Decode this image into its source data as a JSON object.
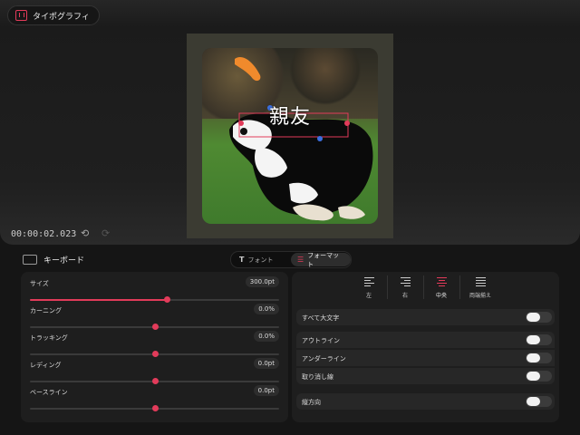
{
  "app": {
    "title": "タイポグラフィ"
  },
  "canvas": {
    "overlay_text": "親友"
  },
  "playback": {
    "timecode": "00:00:02.023",
    "undo_symbol": "⟲",
    "redo_symbol": "⟳"
  },
  "keyboard": {
    "label": "キーボード"
  },
  "tabs": {
    "font": "フォント",
    "format": "フォーマット",
    "font_symbol": "T",
    "format_symbol": "☰"
  },
  "sliders": [
    {
      "label": "サイズ",
      "value": "300.0pt",
      "level": 0.55
    },
    {
      "label": "カーニング",
      "value": "0.0%",
      "level": 0.5
    },
    {
      "label": "トラッキング",
      "value": "0.0%",
      "level": 0.5
    },
    {
      "label": "レディング",
      "value": "0.0pt",
      "level": 0.5
    },
    {
      "label": "ベースライン",
      "value": "0.0pt",
      "level": 0.5
    }
  ],
  "alignment": [
    {
      "label": "左",
      "selected": false
    },
    {
      "label": "右",
      "selected": false
    },
    {
      "label": "中央",
      "selected": true
    },
    {
      "label": "両端揃え",
      "selected": false
    }
  ],
  "toggles": {
    "all_caps": "すべて大文字",
    "outline": "アウトライン",
    "underline": "アンダーライン",
    "strikethrough": "取り消し線",
    "vertical": "縦方向"
  },
  "colors": {
    "accent": "#e23b5a",
    "background": "#151515",
    "panel": "#1e1e1e"
  }
}
